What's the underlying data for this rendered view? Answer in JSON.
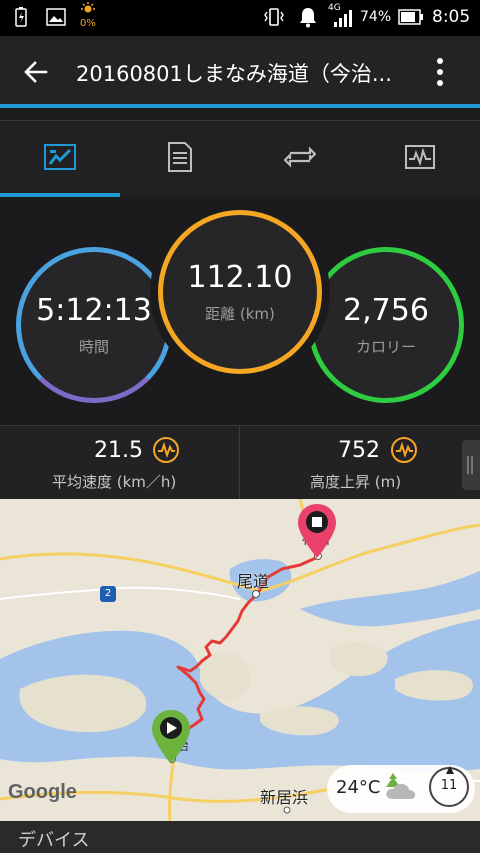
{
  "status_bar": {
    "battery_saver_percent": "0%",
    "network": "4G",
    "battery": "74%",
    "time": "8:05"
  },
  "app_bar": {
    "title": "20160801しまなみ海道（今治..."
  },
  "tabs": [
    {
      "icon": "stats-icon",
      "active": true
    },
    {
      "icon": "details-list-icon",
      "active": false
    },
    {
      "icon": "laps-icon",
      "active": false
    },
    {
      "icon": "chart-icon",
      "active": false
    }
  ],
  "rings": {
    "time": {
      "value": "5:12:13",
      "label": "時間"
    },
    "distance": {
      "value": "112.10",
      "label": "距離 (km)"
    },
    "calories": {
      "value": "2,756",
      "label": "カロリー"
    }
  },
  "stats": {
    "avg_speed": {
      "value": "21.5",
      "label": "平均速度 (km／h)"
    },
    "elevation_gain": {
      "value": "752",
      "label": "高度上昇 (m)"
    }
  },
  "map": {
    "labels": {
      "onomichi": "尾道",
      "niihama": "新居浜",
      "route_number": "2",
      "fukuyama_partial": "福山",
      "imabari_partial": "治"
    },
    "google_logo": "Google",
    "weather_temp": "24°C",
    "wind_value": "11"
  },
  "footer": {
    "label": "デバイス"
  },
  "colors": {
    "accent": "#1f9ad6",
    "time_ring": "#4aa3df",
    "distance_ring": "#f5a623",
    "calorie_ring": "#2ecc40",
    "route": "#e53935"
  }
}
